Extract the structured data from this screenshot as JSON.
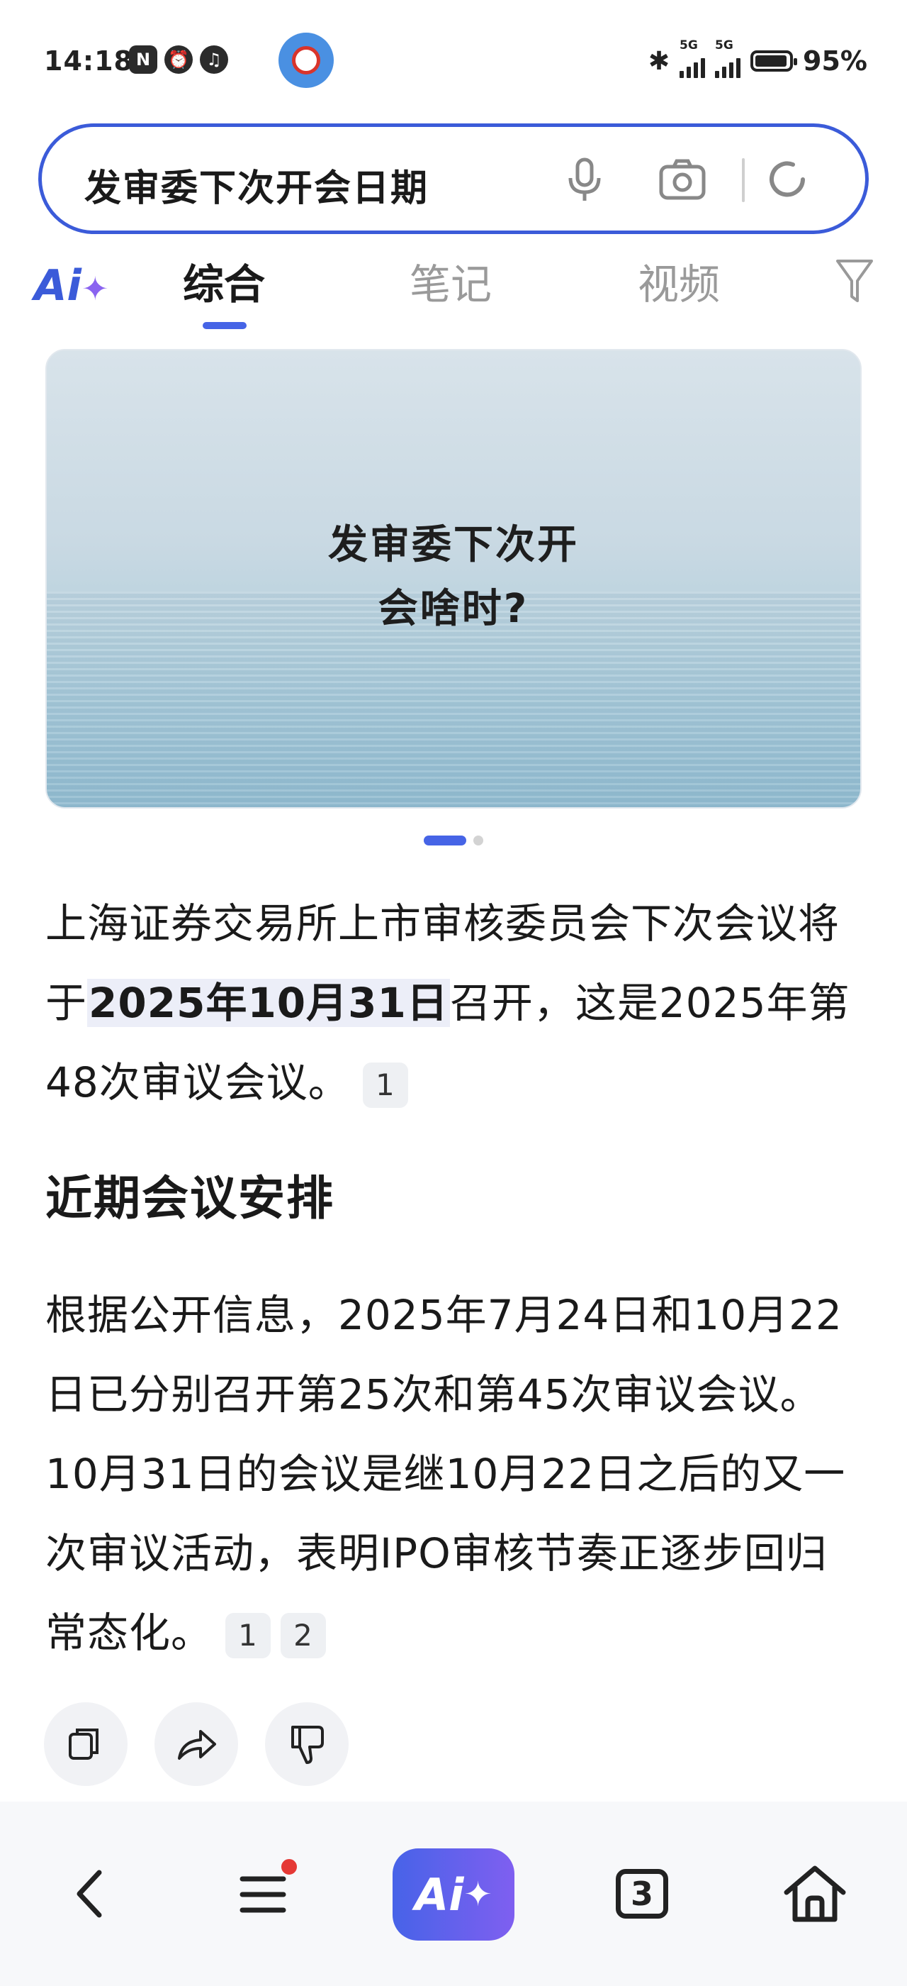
{
  "status_bar": {
    "time": "14:18",
    "left_icons": [
      "nfc-icon",
      "alarm-icon",
      "audio-icon"
    ],
    "network_1": "5G",
    "network_2": "5G",
    "battery": "95%",
    "battery_level": 0.95
  },
  "search": {
    "query": "发审委下次开会日期",
    "icons": [
      "mic-icon",
      "camera-icon",
      "refresh-icon"
    ]
  },
  "tabs": {
    "logo": "Ai",
    "items": [
      {
        "label": "综合",
        "active": true
      },
      {
        "label": "笔记",
        "active": false
      },
      {
        "label": "视频",
        "active": false
      }
    ]
  },
  "hero": {
    "line1": "发审委下次开",
    "line2": "会啥时?"
  },
  "carousel": {
    "pages": 2,
    "current": 1
  },
  "answer": {
    "p1_before": "上海证券交易所上市审核委员会下次会议将于",
    "p1_highlight": "2025年10月31日",
    "p1_after": "召开，这是2025年第48次审议会议。",
    "p1_citations": [
      "1"
    ],
    "heading": "近期会议安排",
    "p2_text": "根据公开信息，2025年7月24日和10月22日已分别召开第25次和第45次审议会议。10月31日的会议是继10月22日之后的又一次审议活动，表明IPO审核节奏正逐步回归常态化。",
    "p2_citations": [
      "1",
      "2"
    ]
  },
  "actions": [
    "copy-icon",
    "share-icon",
    "dislike-icon"
  ],
  "bottom_nav": {
    "ai_label": "Ai",
    "tab_count": "3"
  },
  "colors": {
    "accent": "#4664e6",
    "search_border": "#3b5bd9",
    "ai_gradient_start": "#4763e8",
    "ai_gradient_end": "#7f5ff0",
    "badge": "#e53935"
  }
}
